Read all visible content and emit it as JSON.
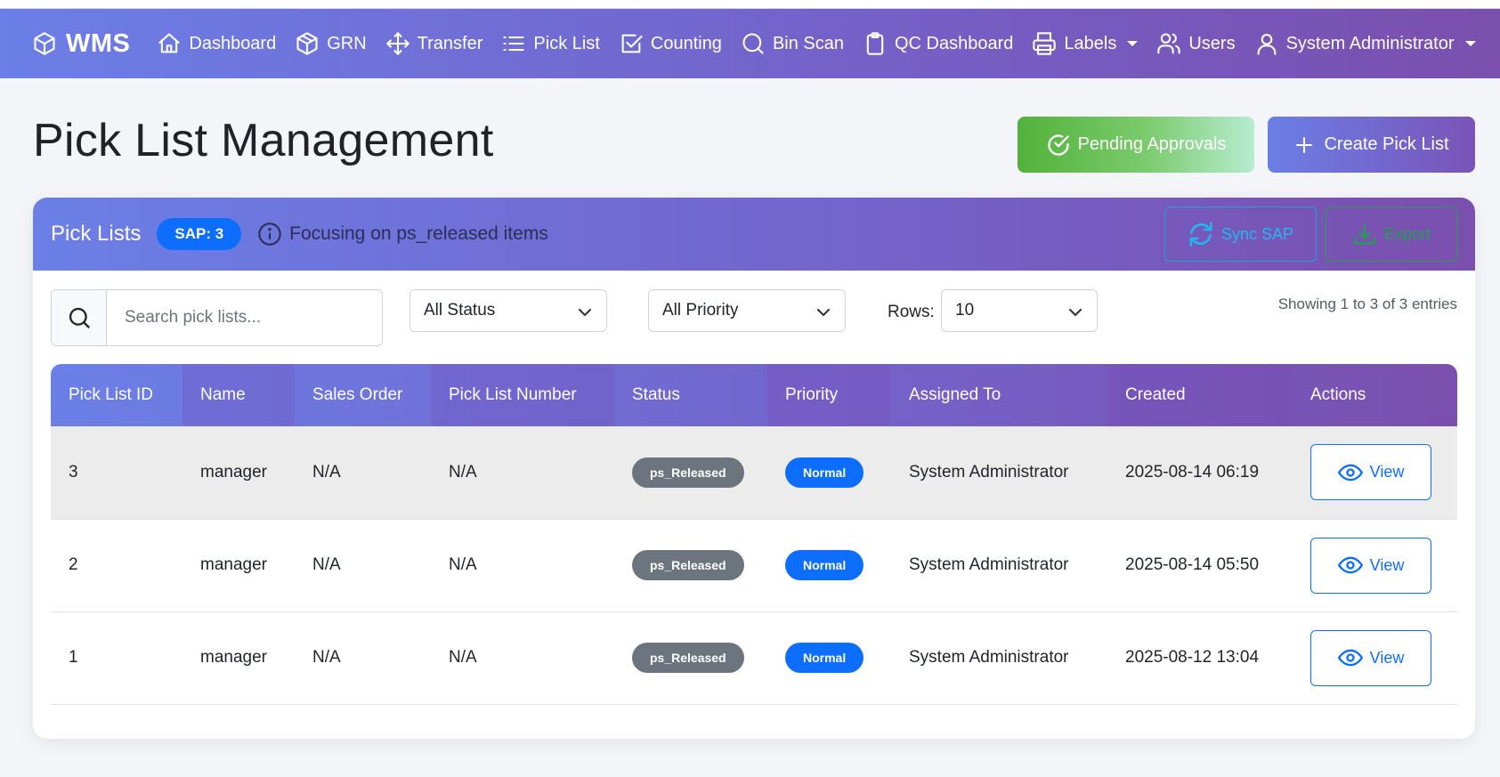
{
  "navbar": {
    "brand": "WMS",
    "items": [
      {
        "label": "Dashboard"
      },
      {
        "label": "GRN"
      },
      {
        "label": "Transfer"
      },
      {
        "label": "Pick List"
      },
      {
        "label": "Counting"
      },
      {
        "label": "Bin Scan"
      },
      {
        "label": "QC Dashboard"
      },
      {
        "label": "Labels"
      },
      {
        "label": "Users"
      },
      {
        "label": "System Administrator"
      }
    ]
  },
  "page": {
    "title": "Pick List Management",
    "pending_approvals_label": "Pending Approvals",
    "create_label": "Create Pick List"
  },
  "card": {
    "title": "Pick Lists",
    "sap_badge": "SAP: 3",
    "focus_text": "Focusing on ps_released items",
    "sync_label": "Sync SAP",
    "export_label": "Export"
  },
  "filters": {
    "search_placeholder": "Search pick lists...",
    "status_value": "All Status",
    "priority_value": "All Priority",
    "rows_label": "Rows:",
    "rows_value": "10",
    "entries_info": "Showing 1 to 3 of 3 entries"
  },
  "table": {
    "headers": [
      "Pick List ID",
      "Name",
      "Sales Order",
      "Pick List Number",
      "Status",
      "Priority",
      "Assigned To",
      "Created",
      "Actions"
    ],
    "rows": [
      {
        "id": "3",
        "name": "manager",
        "sales_order": "N/A",
        "number": "N/A",
        "status": "ps_Released",
        "priority": "Normal",
        "assigned": "System Administrator",
        "created": "2025-08-14 06:19",
        "action": "View"
      },
      {
        "id": "2",
        "name": "manager",
        "sales_order": "N/A",
        "number": "N/A",
        "status": "ps_Released",
        "priority": "Normal",
        "assigned": "System Administrator",
        "created": "2025-08-14 05:50",
        "action": "View"
      },
      {
        "id": "1",
        "name": "manager",
        "sales_order": "N/A",
        "number": "N/A",
        "status": "ps_Released",
        "priority": "Normal",
        "assigned": "System Administrator",
        "created": "2025-08-12 13:04",
        "action": "View"
      }
    ]
  },
  "colors": {
    "nav_gradient_start": "#6b7fe6",
    "nav_gradient_end": "#7a4fae",
    "primary": "#0d6efd",
    "success": "#52b23a",
    "status_badge": "#6c757d"
  },
  "icons": [
    "cube-icon",
    "home-icon",
    "package-icon",
    "move-icon",
    "list-icon",
    "check-square-icon",
    "search-icon",
    "clipboard-icon",
    "printer-icon",
    "users-icon",
    "user-icon",
    "check-circle-icon",
    "plus-icon",
    "info-icon",
    "refresh-icon",
    "download-icon",
    "chevron-down-icon",
    "eye-icon"
  ]
}
